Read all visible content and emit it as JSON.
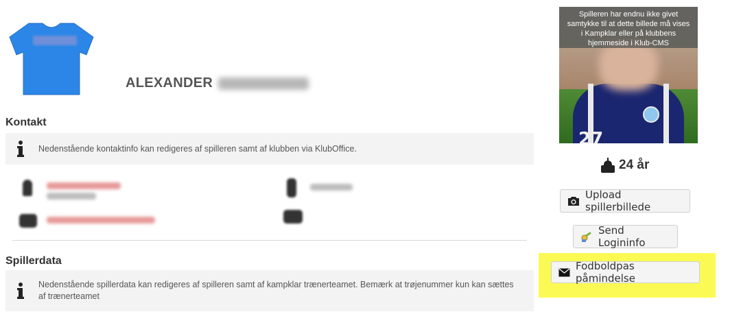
{
  "player": {
    "first_name": "ALEXANDER"
  },
  "sections": {
    "contact": {
      "heading": "Kontakt",
      "info": "Nedenstående kontaktinfo kan redigeres af spilleren samt af klubben via KlubOffice."
    },
    "playerdata": {
      "heading": "Spillerdata",
      "info": "Nedenstående spillerdata kan redigeres af spilleren samt af kampklar trænerteamet. Bemærk at trøjenummer kun kan sættes af trænerteamet"
    }
  },
  "photo": {
    "consent_overlay": "Spilleren har endnu ikke givet samtykke til at dette billede må vises i Kampklar eller på klubbens hjemmeside i Klub-CMS",
    "shirt_number": "27"
  },
  "age": {
    "label": "24 år",
    "icon": "cake-icon"
  },
  "buttons": {
    "upload": "Upload spillerbillede",
    "login": "Send Logininfo",
    "reminder": "Fodboldpas påmindelse"
  },
  "colors": {
    "jersey": "#2b86e8",
    "highlight": "#fbfa55",
    "link_blur": "#e88a8a"
  }
}
